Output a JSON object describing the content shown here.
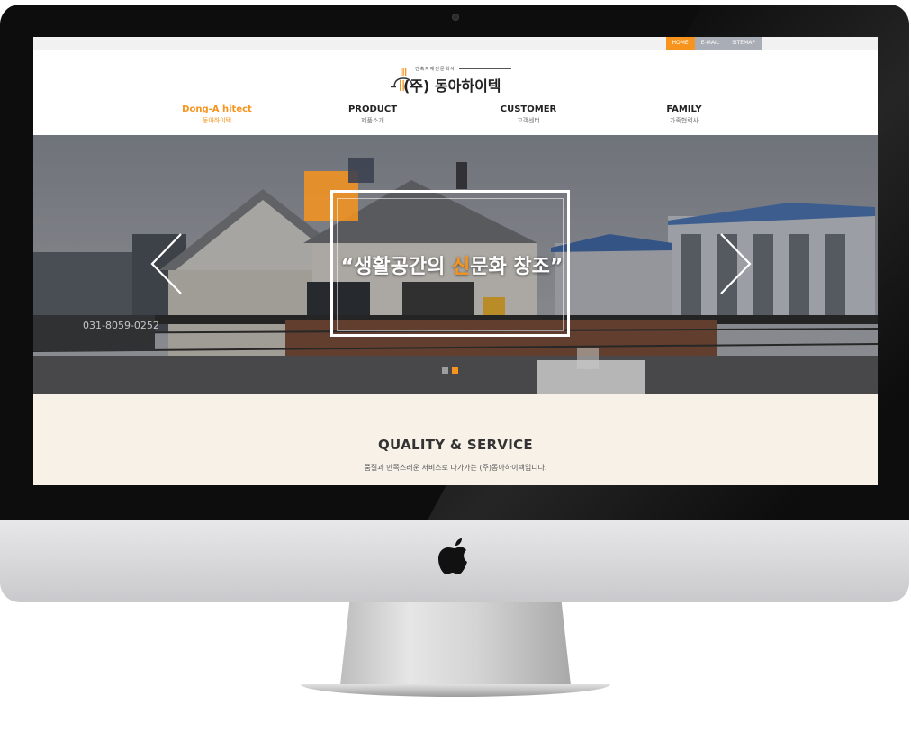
{
  "topbar": {
    "links": [
      {
        "label": "HOME",
        "active": true
      },
      {
        "label": "E-MAIL",
        "active": false
      },
      {
        "label": "SITEMAP",
        "active": false
      }
    ]
  },
  "logo": {
    "subtitle": "건축자재전문회사",
    "name": "(주) 동아하이텍",
    "accent_color": "#f7941d"
  },
  "gnb": {
    "items": [
      {
        "en": "Dong-A hitect",
        "ko": "동아하이텍",
        "active": true
      },
      {
        "en": "PRODUCT",
        "ko": "제품소개",
        "active": false
      },
      {
        "en": "CUSTOMER",
        "ko": "고객센터",
        "active": false
      },
      {
        "en": "FAMILY",
        "ko": "가족협력사",
        "active": false
      }
    ]
  },
  "hero": {
    "title_prefix": "“생활공간의 ",
    "title_highlight": "신",
    "title_suffix": "문화 창조”",
    "sign_text": "031-8059-0252",
    "prev_icon": "chevron-left-icon",
    "next_icon": "chevron-right-icon",
    "slide_count": 2,
    "active_slide": 2
  },
  "quality": {
    "title": "QUALITY & SERVICE",
    "subtitle": "품질과 만족스러운 서비스로 다가가는 (주)동아하이텍입니다."
  },
  "colors": {
    "accent": "#f7941d",
    "section_bg": "#f7f1e8"
  }
}
